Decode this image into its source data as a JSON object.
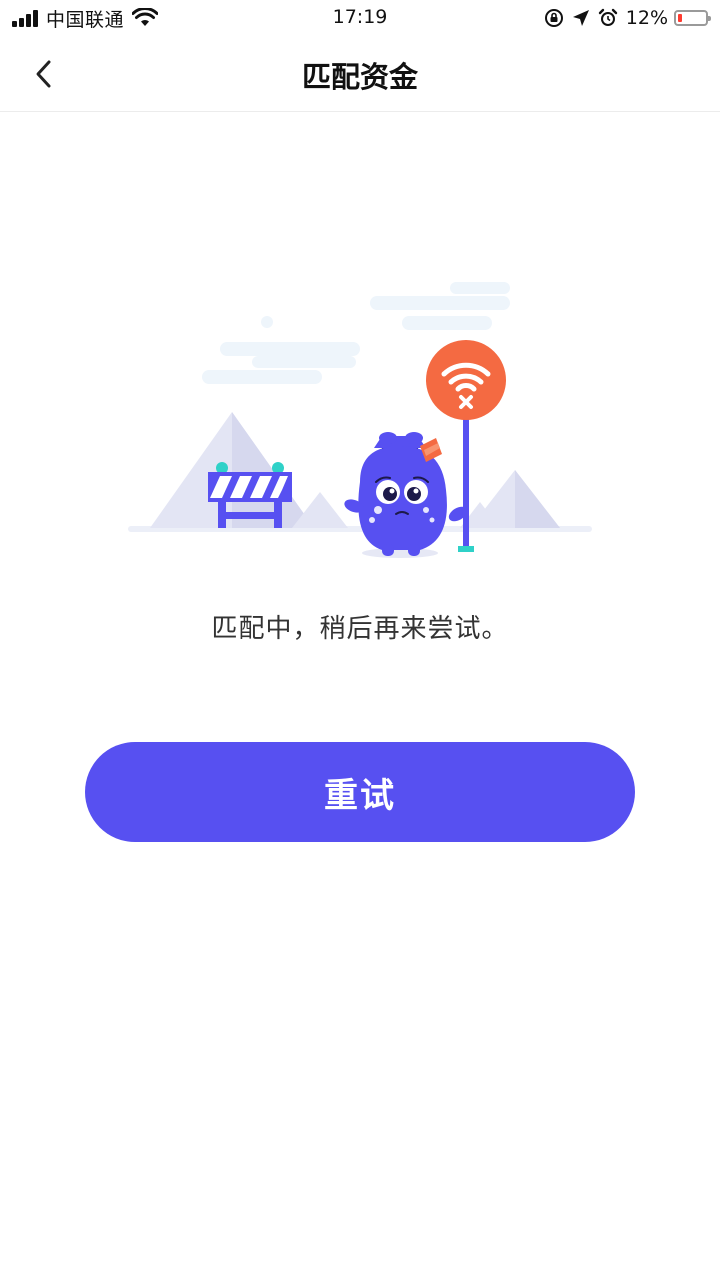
{
  "status_bar": {
    "carrier": "中国联通",
    "time": "17:19",
    "battery_percent": "12%"
  },
  "nav": {
    "title": "匹配资金",
    "back_icon": "chevron-left-icon"
  },
  "content": {
    "message": "匹配中，稍后再来尝试。",
    "retry_label": "重试"
  },
  "colors": {
    "accent": "#5750f1",
    "warning": "#f46a42",
    "teal": "#2fd1c8",
    "battery_low": "#ff3b30"
  }
}
